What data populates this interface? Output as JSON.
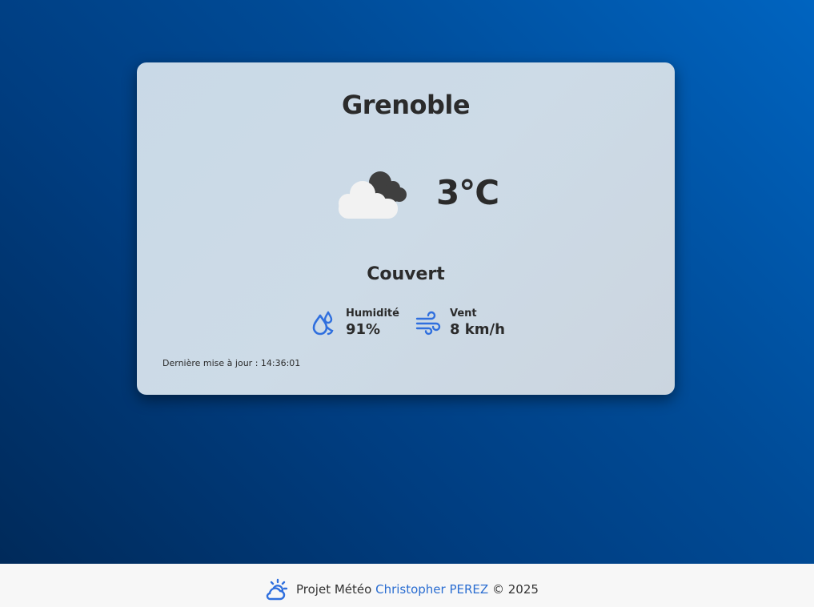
{
  "weather": {
    "city": "Grenoble",
    "temperature": "3°C",
    "condition": "Couvert",
    "icon": "overcast-cloud-icon",
    "humidity": {
      "label": "Humidité",
      "value": "91%",
      "icon": "humidity-drops-icon"
    },
    "wind": {
      "label": "Vent",
      "value": "8 km/h",
      "icon": "wind-icon"
    },
    "last_update": "Dernière mise à jour : 14:36:01"
  },
  "footer": {
    "prefix": "Projet Météo",
    "author": "Christopher PEREZ",
    "suffix": "© 2025",
    "icon": "sun-cloud-icon"
  },
  "colors": {
    "accent": "#2a6dd1",
    "text": "#2b2b2b",
    "background_top": "#0064c0",
    "background_bottom": "#002a5a"
  }
}
